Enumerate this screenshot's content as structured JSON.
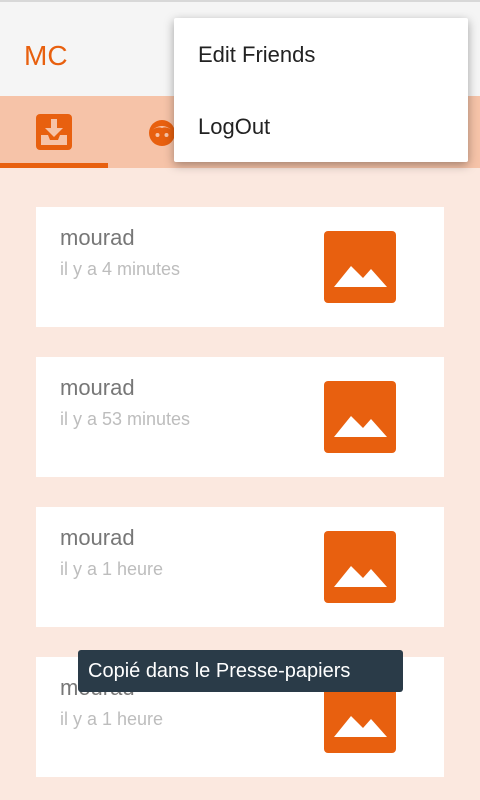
{
  "app_bar": {
    "title": "MC"
  },
  "tabs": [
    {
      "name": "inbox",
      "icon": "inbox-download-icon",
      "selected": true
    },
    {
      "name": "friends",
      "icon": "face-icon",
      "selected": false
    }
  ],
  "overflow_menu": {
    "items": [
      {
        "label": "Edit Friends"
      },
      {
        "label": "LogOut"
      }
    ]
  },
  "messages": [
    {
      "sender": "mourad",
      "time": "il y a 4 minutes",
      "icon": "image-icon"
    },
    {
      "sender": "mourad",
      "time": "il y a 53 minutes",
      "icon": "image-icon"
    },
    {
      "sender": "mourad",
      "time": "il y a 1 heure",
      "icon": "image-icon"
    },
    {
      "sender": "mourad",
      "time": "il y a 1 heure",
      "icon": "image-icon"
    }
  ],
  "toast": {
    "text": "Copié dans le Presse-papiers"
  },
  "colors": {
    "accent": "#e8600f",
    "tab_bar": "#f6c3a8",
    "background": "#fbe8df",
    "toast": "#2a3b48"
  }
}
